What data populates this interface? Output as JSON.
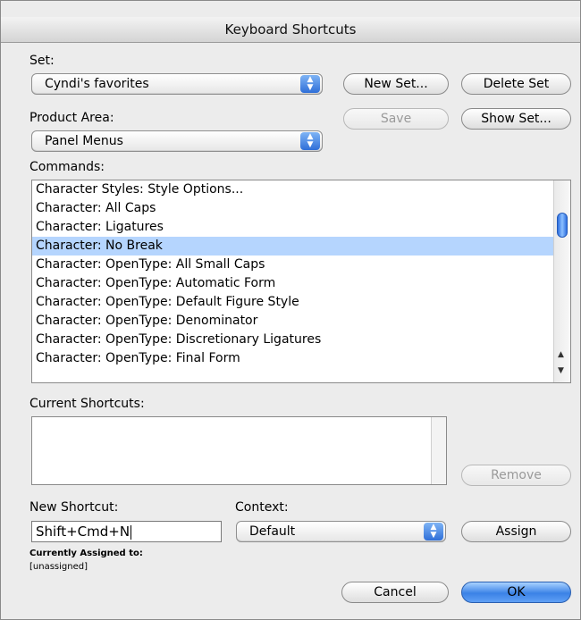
{
  "window": {
    "title": "Keyboard Shortcuts"
  },
  "set": {
    "label": "Set:",
    "value": "Cyndi's favorites",
    "new_set_label": "New Set...",
    "delete_set_label": "Delete Set"
  },
  "product_area": {
    "label": "Product Area:",
    "value": "Panel Menus",
    "save_label": "Save",
    "show_set_label": "Show Set..."
  },
  "commands": {
    "label": "Commands:",
    "items": [
      "Character Styles: Style Options...",
      "Character: All Caps",
      "Character: Ligatures",
      "Character: No Break",
      "Character: OpenType: All Small Caps",
      "Character: OpenType: Automatic Form",
      "Character: OpenType: Default Figure Style",
      "Character: OpenType: Denominator",
      "Character: OpenType: Discretionary Ligatures",
      "Character: OpenType: Final Form"
    ],
    "selected_index": 3
  },
  "current_shortcuts": {
    "label": "Current Shortcuts:",
    "remove_label": "Remove"
  },
  "new_shortcut": {
    "label": "New Shortcut:",
    "value": "Shift+Cmd+N"
  },
  "context": {
    "label": "Context:",
    "value": "Default",
    "assign_label": "Assign"
  },
  "assigned": {
    "label": "Currently Assigned to:",
    "value": "[unassigned]"
  },
  "footer": {
    "cancel_label": "Cancel",
    "ok_label": "OK"
  },
  "colors": {
    "selection": "#b5d5fe",
    "accent_blue": "#3b82e6",
    "window_bg": "#ececec"
  }
}
